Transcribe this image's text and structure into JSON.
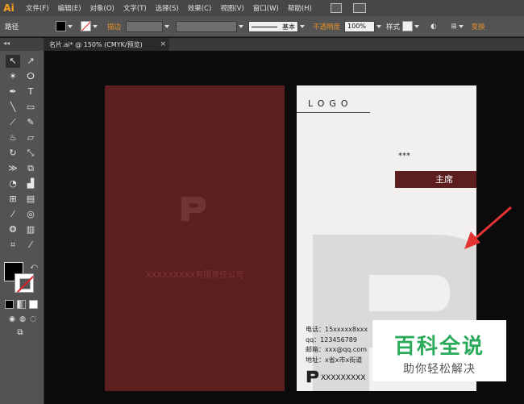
{
  "app": {
    "logo": "Ai"
  },
  "menu": [
    "文件(F)",
    "编辑(E)",
    "对象(O)",
    "文字(T)",
    "选择(S)",
    "效果(C)",
    "视图(V)",
    "窗口(W)",
    "帮助(H)"
  ],
  "control": {
    "selection_label": "路径",
    "stroke_label": "描边",
    "brush_label": "基本",
    "opacity_label": "不透明度",
    "opacity_value": "100%",
    "style_label": "样式",
    "transform_label": "变换"
  },
  "tab": {
    "title": "名片.ai* @ 150% (CMYK/预览)",
    "close": "×"
  },
  "toolbar": {
    "header": "◂◂"
  },
  "card_front": {
    "company": "XXXXXXXXX有限责任公司"
  },
  "card_back": {
    "logo_text": "LOGO",
    "name": "***",
    "title": "主席",
    "contact": [
      "电话：15xxxxx8xxx",
      "qq：123456789",
      "邮箱：xxx@qq.com",
      "地址：x省x市x街道"
    ],
    "footer_company": "XXXXXXXXX"
  },
  "watermark": {
    "title": "百科全说",
    "subtitle": "助你轻松解决"
  },
  "colors": {
    "card_red": "#5c1e1f",
    "accent_orange": "#e8912b",
    "arrow_red": "#e53333",
    "watermark_green": "#2aaa5a"
  }
}
